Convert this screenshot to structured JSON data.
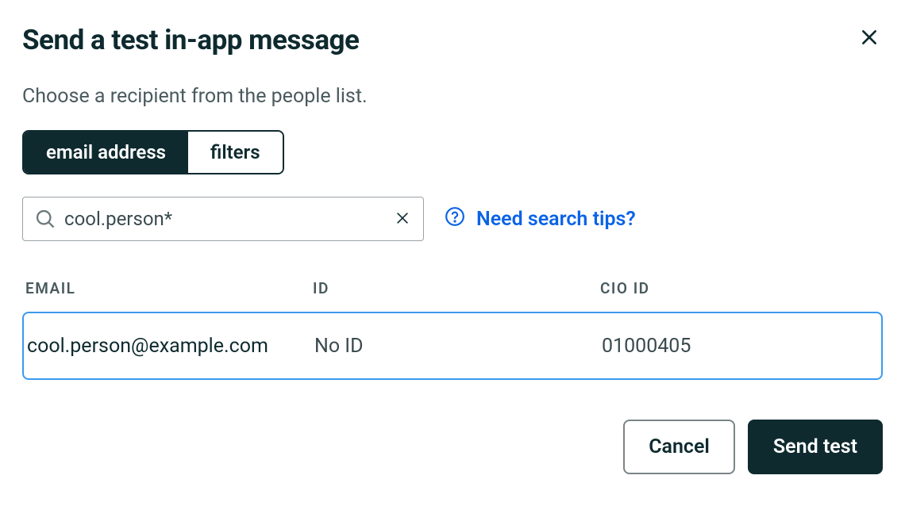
{
  "modal": {
    "title": "Send a test in-app message",
    "subtitle": "Choose a recipient from the people list."
  },
  "segmented": {
    "email_label": "email address",
    "filters_label": "filters",
    "active": "email"
  },
  "search": {
    "value": "cool.person*",
    "placeholder": ""
  },
  "help": {
    "label": "Need search tips?"
  },
  "table": {
    "headers": {
      "email": "EMAIL",
      "id": "ID",
      "cio_id": "CIO ID"
    },
    "rows": [
      {
        "email": "cool.person@example.com",
        "id": "No ID",
        "cio_id": "01000405"
      }
    ]
  },
  "footer": {
    "cancel": "Cancel",
    "send": "Send test"
  }
}
